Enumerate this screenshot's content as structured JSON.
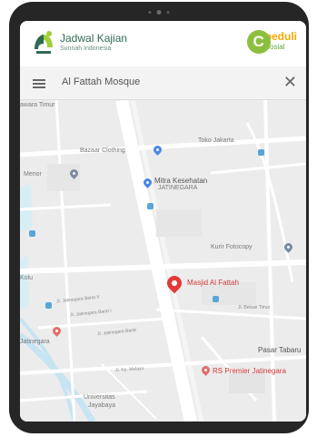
{
  "brand": {
    "left_title": "Jadwal Kajian",
    "left_subtitle": "Sunnah Indonesia",
    "right_mark": "C",
    "right_word1": "peduli",
    "right_word2": "Sosial"
  },
  "search": {
    "query": "Al Fattah Mosque",
    "close_glyph": "✕"
  },
  "map": {
    "labels": {
      "top_left": "awara Timur",
      "bazaar": "Bazaar Clothing",
      "store": "Toko Jakarta",
      "menor": "Menor",
      "mitra": "Mitra Kesehatan",
      "mitra2": "JATINEGARA",
      "kurir": "Kurir Fotocopy",
      "mosque": "Masjid Al Fattah",
      "kolu": "Kolu",
      "jatinegara": "Jatinegara",
      "plaza": "Pasar Tabaru",
      "rs": "RS Premier Jatinegara",
      "universitas1": "Universitas",
      "universitas2": "Jayabaya",
      "st1": "Jl. Jatinegara Barat II",
      "st2": "Jl. Jatinegara Barat I",
      "st3": "Jl. Jatinegara Barat",
      "st4": "Jl. Kp. Melayu",
      "st5": "Jl. Bekasi Timur"
    }
  },
  "colors": {
    "device": "#262626",
    "mosque_pin": "#e53935",
    "map_bg": "#ececec"
  }
}
